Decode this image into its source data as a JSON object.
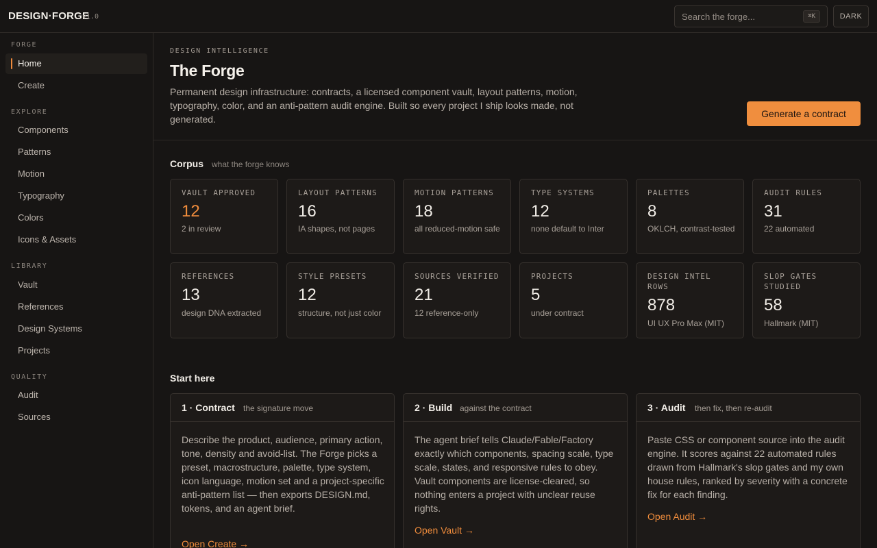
{
  "app": {
    "brand": "DESIGN·FORGE",
    "version": "v1.0"
  },
  "search": {
    "placeholder": "Search the forge...",
    "shortcut": "⌘K"
  },
  "theme_toggle": "DARK",
  "sidebar": {
    "sections": [
      {
        "title": "FORGE",
        "items": [
          "Home",
          "Create"
        ]
      },
      {
        "title": "EXPLORE",
        "items": [
          "Components",
          "Patterns",
          "Motion",
          "Typography",
          "Colors",
          "Icons & Assets"
        ]
      },
      {
        "title": "LIBRARY",
        "items": [
          "Vault",
          "References",
          "Design Systems",
          "Projects"
        ]
      },
      {
        "title": "QUALITY",
        "items": [
          "Audit",
          "Sources"
        ]
      }
    ],
    "active_item": "Home"
  },
  "hero": {
    "eyebrow": "DESIGN INTELLIGENCE",
    "title": "The Forge",
    "description": "Permanent design infrastructure: contracts, a licensed component vault, layout patterns, motion, typography, color, and an anti-pattern audit engine. Built so every project I ship looks made, not generated.",
    "cta": "Generate a contract"
  },
  "corpus": {
    "title": "Corpus",
    "subtitle": "what the forge knows",
    "stats": [
      {
        "label": "VAULT APPROVED",
        "value": "12",
        "note": "2 in review"
      },
      {
        "label": "LAYOUT PATTERNS",
        "value": "16",
        "note": "IA shapes, not pages"
      },
      {
        "label": "MOTION PATTERNS",
        "value": "18",
        "note": "all reduced-motion safe"
      },
      {
        "label": "TYPE SYSTEMS",
        "value": "12",
        "note": "none default to Inter"
      },
      {
        "label": "PALETTES",
        "value": "8",
        "note": "OKLCH, contrast-tested"
      },
      {
        "label": "AUDIT RULES",
        "value": "31",
        "note": "22 automated"
      },
      {
        "label": "REFERENCES",
        "value": "13",
        "note": "design DNA extracted"
      },
      {
        "label": "STYLE PRESETS",
        "value": "12",
        "note": "structure, not just color"
      },
      {
        "label": "SOURCES VERIFIED",
        "value": "21",
        "note": "12 reference-only"
      },
      {
        "label": "PROJECTS",
        "value": "5",
        "note": "under contract"
      },
      {
        "label": "DESIGN INTEL ROWS",
        "value": "878",
        "note": "UI UX Pro Max (MIT)"
      },
      {
        "label": "SLOP GATES STUDIED",
        "value": "58",
        "note": "Hallmark (MIT)"
      }
    ]
  },
  "start": {
    "title": "Start here",
    "steps": [
      {
        "title": "1 · Contract",
        "tag": "the signature move",
        "body": "Describe the product, audience, primary action, tone, density and avoid-list. The Forge picks a preset, macrostructure, palette, type system, icon language, motion set and a project-specific anti-pattern list — then exports DESIGN.md, tokens, and an agent brief.",
        "link": "Open Create →"
      },
      {
        "title": "2 · Build",
        "tag": "against the contract",
        "body": "The agent brief tells Claude/Fable/Factory exactly which components, spacing scale, type scale, states, and responsive rules to obey. Vault components are license-cleared, so nothing enters a project with unclear reuse rights.",
        "link": "Open Vault →"
      },
      {
        "title": "3 · Audit",
        "tag": "then fix, then re-audit",
        "body": "Paste CSS or component source into the audit engine. It scores against 22 automated rules drawn from Hallmark's slop gates and my own house rules, ranked by severity with a concrete fix for each finding.",
        "link": "Open Audit →"
      }
    ]
  },
  "colors": {
    "accent": "#ef8c3c",
    "background": "#171514",
    "surface": "#1d1a18",
    "border": "#36312d"
  }
}
